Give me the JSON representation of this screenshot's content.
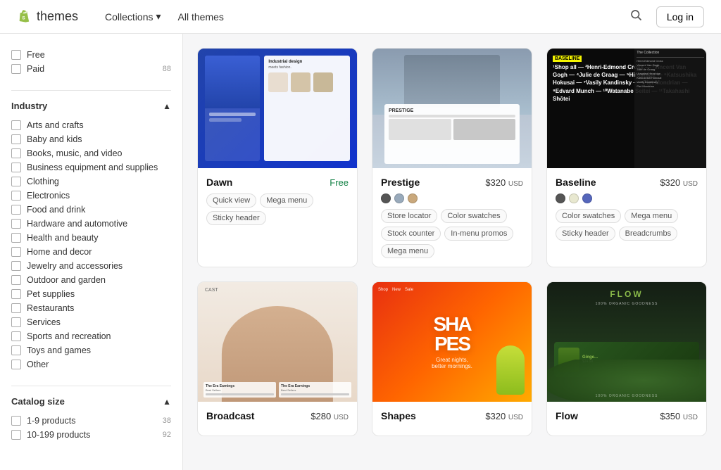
{
  "navbar": {
    "brand": "themes",
    "nav_items": [
      {
        "label": "Collections",
        "has_dropdown": true
      },
      {
        "label": "All themes",
        "has_dropdown": false
      }
    ],
    "login_label": "Log in"
  },
  "sidebar": {
    "price_filters": [
      {
        "label": "Free",
        "count": ""
      },
      {
        "label": "Paid",
        "count": "88"
      }
    ],
    "industry_title": "Industry",
    "industry_filters": [
      {
        "label": "Arts and crafts",
        "count": ""
      },
      {
        "label": "Baby and kids",
        "count": ""
      },
      {
        "label": "Books, music, and video",
        "count": ""
      },
      {
        "label": "Business equipment and supplies",
        "count": ""
      },
      {
        "label": "Clothing",
        "count": ""
      },
      {
        "label": "Electronics",
        "count": ""
      },
      {
        "label": "Food and drink",
        "count": ""
      },
      {
        "label": "Hardware and automotive",
        "count": ""
      },
      {
        "label": "Health and beauty",
        "count": ""
      },
      {
        "label": "Home and decor",
        "count": ""
      },
      {
        "label": "Jewelry and accessories",
        "count": ""
      },
      {
        "label": "Outdoor and garden",
        "count": ""
      },
      {
        "label": "Pet supplies",
        "count": ""
      },
      {
        "label": "Restaurants",
        "count": ""
      },
      {
        "label": "Services",
        "count": ""
      },
      {
        "label": "Sports and recreation",
        "count": ""
      },
      {
        "label": "Toys and games",
        "count": ""
      },
      {
        "label": "Other",
        "count": ""
      }
    ],
    "catalog_title": "Catalog size",
    "catalog_filters": [
      {
        "label": "1-9 products",
        "count": "38"
      },
      {
        "label": "10-199 products",
        "count": "92"
      }
    ]
  },
  "themes": [
    {
      "name": "Dawn",
      "price": "Free",
      "is_free": true,
      "tags": [
        "Quick view",
        "Mega menu",
        "Sticky header"
      ],
      "swatches": [],
      "type": "dawn"
    },
    {
      "name": "Prestige",
      "price": "$320",
      "currency": "USD",
      "is_free": false,
      "swatches": [
        "#555",
        "#9ab",
        "#c9a87c"
      ],
      "tags": [
        "Store locator",
        "Color swatches",
        "Stock counter",
        "In-menu promos",
        "Mega menu"
      ],
      "type": "prestige"
    },
    {
      "name": "Baseline",
      "price": "$320",
      "currency": "USD",
      "is_free": false,
      "swatches": [
        "#555",
        "#e8e8d0",
        "#5566bb"
      ],
      "tags": [
        "Color swatches",
        "Mega menu",
        "Sticky header",
        "Breadcrumbs"
      ],
      "type": "baseline"
    },
    {
      "name": "Broadcast",
      "price": "$280",
      "currency": "USD",
      "is_free": false,
      "swatches": [],
      "tags": [],
      "type": "broadcast"
    },
    {
      "name": "Shapes",
      "price": "$320",
      "currency": "USD",
      "is_free": false,
      "swatches": [],
      "tags": [],
      "type": "shapes"
    },
    {
      "name": "Flow",
      "price": "$350",
      "currency": "USD",
      "is_free": false,
      "swatches": [],
      "tags": [],
      "type": "flow"
    }
  ]
}
